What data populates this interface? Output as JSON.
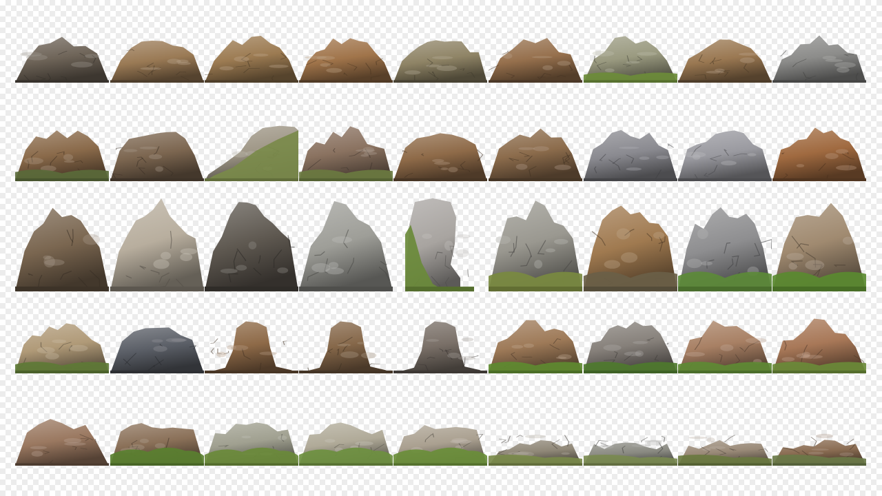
{
  "sheet": {
    "background": "transparency-checkerboard",
    "rows": [
      {
        "items": [
          {
            "kind": "rock",
            "color": "#6e6458",
            "grass": ""
          },
          {
            "kind": "rock",
            "color": "#9a7a55",
            "grass": ""
          },
          {
            "kind": "rock",
            "color": "#9c7b52",
            "grass": ""
          },
          {
            "kind": "rock",
            "color": "#a0744a",
            "grass": ""
          },
          {
            "kind": "rock",
            "color": "#8f8466",
            "grass": ""
          },
          {
            "kind": "rock",
            "color": "#96704d",
            "grass": ""
          },
          {
            "kind": "grassy-rock",
            "color": "#9a9a80",
            "grass": "#6d8c3a"
          },
          {
            "kind": "rock",
            "color": "#9a7852",
            "grass": ""
          },
          {
            "kind": "rock",
            "color": "#8c8c8a",
            "grass": ""
          }
        ]
      },
      {
        "items": [
          {
            "kind": "rock",
            "color": "#8a6a4a",
            "grass": "#5a6a3a"
          },
          {
            "kind": "rock",
            "color": "#7c6650",
            "grass": ""
          },
          {
            "kind": "grassy-slope",
            "color": "#a09888",
            "grass": "#7a8a4a"
          },
          {
            "kind": "grassy-rock",
            "color": "#8a7260",
            "grass": "#6a7a40"
          },
          {
            "kind": "rock",
            "color": "#8e6a48",
            "grass": ""
          },
          {
            "kind": "rock",
            "color": "#8c6c4c",
            "grass": ""
          },
          {
            "kind": "rock",
            "color": "#8a8a90",
            "grass": ""
          },
          {
            "kind": "rock",
            "color": "#9a9aa0",
            "grass": ""
          },
          {
            "kind": "rock",
            "color": "#a06a40",
            "grass": ""
          }
        ]
      },
      {
        "items": [
          {
            "kind": "rock",
            "color": "#7a6650",
            "grass": ""
          },
          {
            "kind": "rock",
            "color": "#b8ae9e",
            "grass": ""
          },
          {
            "kind": "rock",
            "color": "#5e5850",
            "grass": ""
          },
          {
            "kind": "rock",
            "color": "#9e9e98",
            "grass": ""
          },
          {
            "kind": "tall-rock",
            "color": "#a8a4a0",
            "grass": "#6a8a3a"
          },
          {
            "kind": "grassy-rock",
            "color": "#9a9890",
            "grass": "#7a8a40"
          },
          {
            "kind": "rock",
            "color": "#a07a50",
            "grass": "#6a6048"
          },
          {
            "kind": "grassy-rock",
            "color": "#8e8e90",
            "grass": "#5c8a38"
          },
          {
            "kind": "grassy-rock",
            "color": "#a08a70",
            "grass": "#5a8a30"
          }
        ]
      },
      {
        "items": [
          {
            "kind": "grassy-rock",
            "color": "#b09a78",
            "grass": "#5e7a36"
          },
          {
            "kind": "rock",
            "color": "#5a5e66",
            "grass": ""
          },
          {
            "kind": "pillar",
            "color": "#8e6a48",
            "grass": ""
          },
          {
            "kind": "pillar",
            "color": "#86684a",
            "grass": ""
          },
          {
            "kind": "pillar",
            "color": "#7a7068",
            "grass": ""
          },
          {
            "kind": "grassy-rock",
            "color": "#9e7a58",
            "grass": "#5e8a30"
          },
          {
            "kind": "grassy-rock",
            "color": "#86807a",
            "grass": "#4e7a2e"
          },
          {
            "kind": "grassy-rock",
            "color": "#a88064",
            "grass": "#5e8a34"
          },
          {
            "kind": "grassy-rock",
            "color": "#a87858",
            "grass": "#6a8a38"
          }
        ]
      },
      {
        "items": [
          {
            "kind": "rock",
            "color": "#9a7860",
            "grass": ""
          },
          {
            "kind": "grassy-mound",
            "color": "#8a7058",
            "grass": "#5a8030"
          },
          {
            "kind": "grassy-mound",
            "color": "#a0a090",
            "grass": "#6a8a3a"
          },
          {
            "kind": "grassy-mound",
            "color": "#b0aa98",
            "grass": "#6e9040"
          },
          {
            "kind": "grassy-mound",
            "color": "#aaa090",
            "grass": "#6a8e3a"
          },
          {
            "kind": "low-outcrop",
            "color": "#908878",
            "grass": "#7a8a4a"
          },
          {
            "kind": "low-outcrop",
            "color": "#8a8a82",
            "grass": "#7a8a50"
          },
          {
            "kind": "low-outcrop",
            "color": "#9a8a78",
            "grass": "#6a7a40"
          },
          {
            "kind": "low-outcrop",
            "color": "#8a6c52",
            "grass": "#6a7a48"
          }
        ]
      }
    ]
  }
}
